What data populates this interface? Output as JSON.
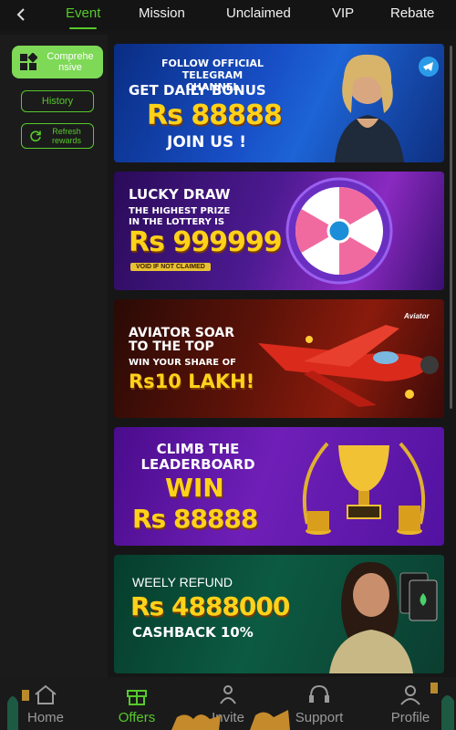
{
  "tabs": [
    {
      "label": "Event",
      "active": true
    },
    {
      "label": "Mission",
      "active": false
    },
    {
      "label": "Unclaimed",
      "active": false
    },
    {
      "label": "VIP",
      "active": false
    },
    {
      "label": "Rebate",
      "active": false
    }
  ],
  "sidebar": {
    "comprehensive_label": "Comprehe nsive",
    "history_label": "History",
    "refresh_label": "Refresh rewards"
  },
  "banners": {
    "telegram": {
      "line1": "FOLLOW OFFICIAL TELEGRAM CHANNEL",
      "line2": "GET DAILY BONUS",
      "amount": "Rs 88888",
      "cta": "JOIN US !"
    },
    "lucky_draw": {
      "title": "LUCKY DRAW",
      "subtitle": "THE HIGHEST PRIZE IN THE LOTTERY IS",
      "amount": "Rs 999999",
      "note": "VOID IF NOT CLAIMED"
    },
    "aviator": {
      "title": "AVIATOR SOAR TO THE TOP",
      "subtitle": "WIN YOUR SHARE OF",
      "amount": "Rs10 LAKH!",
      "logo": "Aviator"
    },
    "leaderboard": {
      "title": "CLIMB THE LEADERBOARD",
      "win": "WIN",
      "amount": "Rs 88888"
    },
    "refund": {
      "title": "WEELY REFUND",
      "amount": "Rs 4888000",
      "cashback": "CASHBACK 10%"
    }
  },
  "bottom_nav": [
    {
      "label": "Home",
      "icon": "home-icon",
      "active": false
    },
    {
      "label": "Offers",
      "icon": "gift-icon",
      "active": true
    },
    {
      "label": "Invite",
      "icon": "invite-icon",
      "active": false
    },
    {
      "label": "Support",
      "icon": "headset-icon",
      "active": false
    },
    {
      "label": "Profile",
      "icon": "profile-icon",
      "active": false
    }
  ],
  "colors": {
    "accent": "#57c92c",
    "active_button": "#7ed957",
    "background": "#161616",
    "inactive_nav": "#9a9a9a"
  }
}
